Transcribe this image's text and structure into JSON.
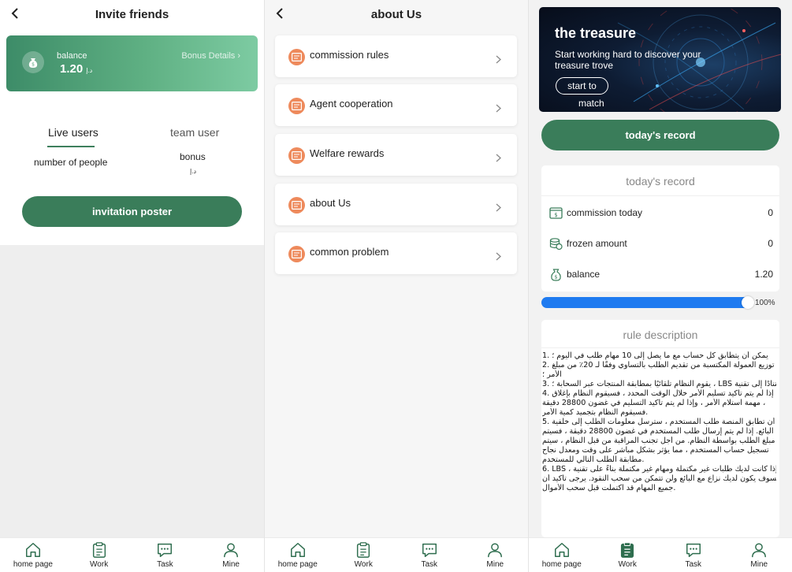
{
  "invite": {
    "title": "Invite friends",
    "balance_label": "balance",
    "balance_value": "1.20",
    "currency": "د.إ",
    "bonus_details": "Bonus Details",
    "tabs": [
      "Live users",
      "team user"
    ],
    "stat_people": "number of people",
    "stat_bonus": "bonus",
    "bonus_value": "د.إ",
    "invite_button": "invitation poster"
  },
  "about": {
    "title": "about Us",
    "items": [
      {
        "label": "commission rules"
      },
      {
        "label": "Agent cooperation"
      },
      {
        "label": "Welfare rewards"
      },
      {
        "label": "about Us"
      },
      {
        "label": "common problem"
      }
    ]
  },
  "work": {
    "banner": {
      "title": "the treasure",
      "subtitle": "Start working hard to discover your treasure trove",
      "button": "start to",
      "button_line2": "match"
    },
    "record_button": "today's record",
    "record_card": {
      "title": "today's record",
      "rows": [
        {
          "label": "commission today",
          "value": "0",
          "icon": "money-note-icon"
        },
        {
          "label": "frozen amount",
          "value": "0",
          "icon": "coins-stack-icon"
        },
        {
          "label": "balance",
          "value": "1.20",
          "icon": "money-bag-icon"
        }
      ]
    },
    "progress": {
      "value": 1.0,
      "label": "100%"
    },
    "rules": {
      "title": "rule description",
      "lines": [
        "1. يمكن أن يتطابق كل حساب مع ما يصل إلى 10 مهام طلب في اليوم ؛",
        "2. يتم توزيع العمولة المكتسبة من تقديم الطلب بالتساوي وفقًا لـ 20٪ من مبلغ",
        "الأمر ؛",
        "3. يقوم النظام تلقائيًا بمطابقة المنتجات عبر السحابة ؛ ، LBS استنادًا إلى تقنية",
        "4. إذا لم يتم تأكيد تسليم الأمر خلال الوقت المحدد ، فسيقوم النظام بإغلاق",
        "مهمة استلام الأمر ، وإذا لم يتم تأكيد التسليم في غضون 28800 دقيقة ،",
        "فسيقوم النظام بتجميد كمية الأمر.",
        "5. بعد أن تطابق المنصة طلب المستخدم ، سترسل معلومات الطلب إلى خلفية",
        "البائع. إذا لم يتم إرسال طلب المستخدم في غضون 28800 دقيقة ، فسيتم",
        "تجميد مبلغ الطلب بواسطة النظام. من أجل تجنب المراقبة من قبل النظام ، سيتم",
        "تسجيل حساب المستخدم ، مما يؤثر بشكل مباشر على وقت ومعدل نجاح",
        "مطابقة الطلب التالي للمستخدم.",
        "6. LBS ، إذا كانت لديك طلبات غير مكتملة ومهام غير مكتملة بناءً على تقنية",
        "فسوف يكون لديك نزاع مع البائع ولن تتمكن من سحب النقود. يرجى تأكيد أن",
        "جميع المهام قد اكتملت قبل سحب الأموال."
      ]
    }
  },
  "nav": {
    "items": [
      {
        "label": "home page",
        "icon": "home-icon"
      },
      {
        "label": "Work",
        "icon": "clipboard-icon"
      },
      {
        "label": "Task",
        "icon": "chat-icon"
      },
      {
        "label": "Mine",
        "icon": "person-icon"
      }
    ],
    "active_color": "#2f6e4f"
  },
  "colors": {
    "primary": "#3a7d5a",
    "menu_icon": "#ee8a5c",
    "progress": "#1f7bf0"
  }
}
